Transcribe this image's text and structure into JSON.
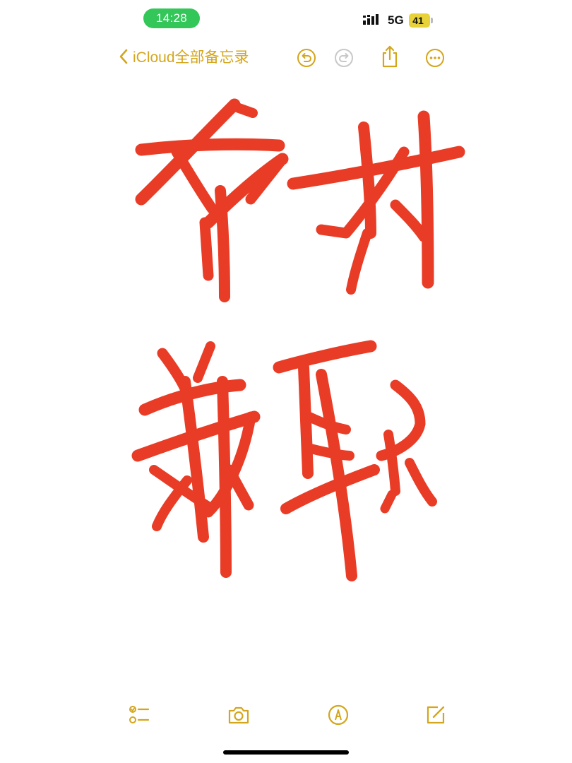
{
  "status_bar": {
    "time": "14:28",
    "network": "5G",
    "battery": "41",
    "pill_color": "#33c759"
  },
  "nav": {
    "back_label": "iCloud全部备忘录",
    "accent_color": "#d4a61c",
    "icons": [
      "undo-icon",
      "redo-icon",
      "share-icon",
      "more-icon"
    ]
  },
  "note": {
    "handwritten_text": [
      "布衬",
      "兼职"
    ],
    "ink_color": "#e8321b"
  },
  "toolbar": {
    "icons": [
      "checklist-icon",
      "camera-icon",
      "markup-icon",
      "compose-icon"
    ]
  }
}
